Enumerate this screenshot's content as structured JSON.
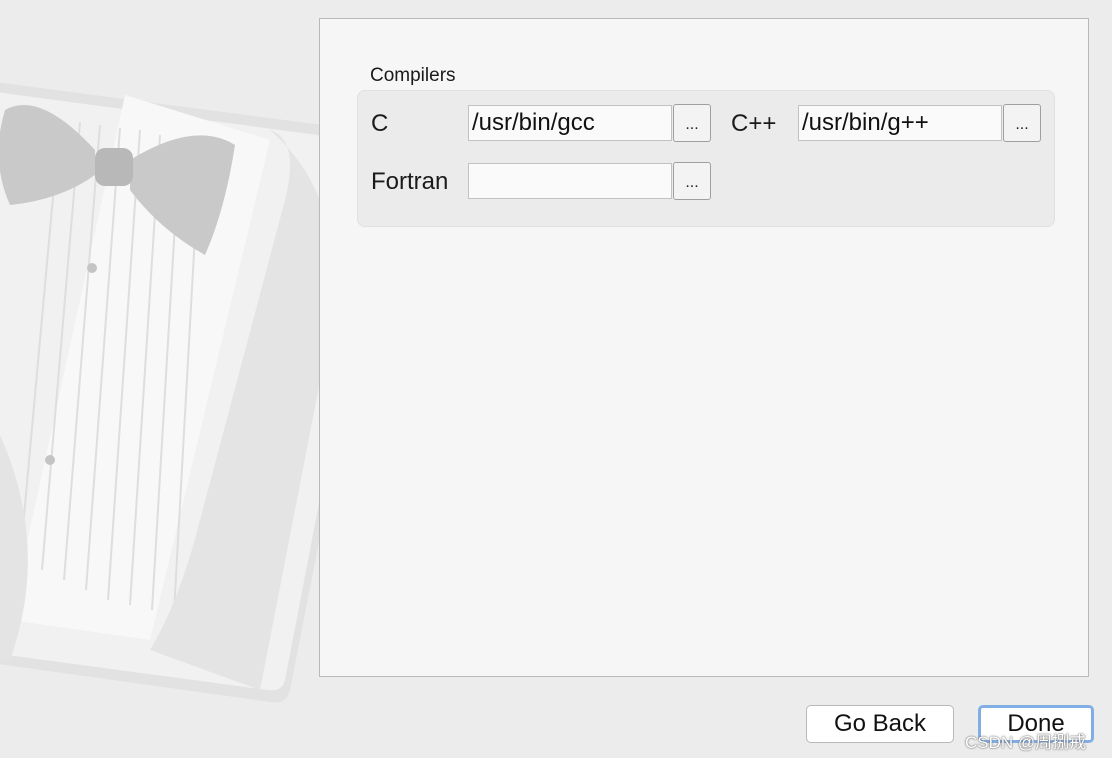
{
  "backdrop": {
    "icon": "tuxedo-logo"
  },
  "compilers": {
    "title": "Compilers",
    "c": {
      "label": "C",
      "value": "/usr/bin/gcc",
      "browse": "..."
    },
    "cpp": {
      "label": "C++",
      "value": "/usr/bin/g++",
      "browse": "..."
    },
    "fortran": {
      "label": "Fortran",
      "value": "",
      "browse": "..."
    }
  },
  "footer": {
    "back_label": "Go Back",
    "done_label": "Done"
  },
  "watermark": "CSDN @周捌戒",
  "colors": {
    "panel": "#f6f6f6",
    "group": "#ebebeb",
    "default_button_border": "#82aee6"
  }
}
